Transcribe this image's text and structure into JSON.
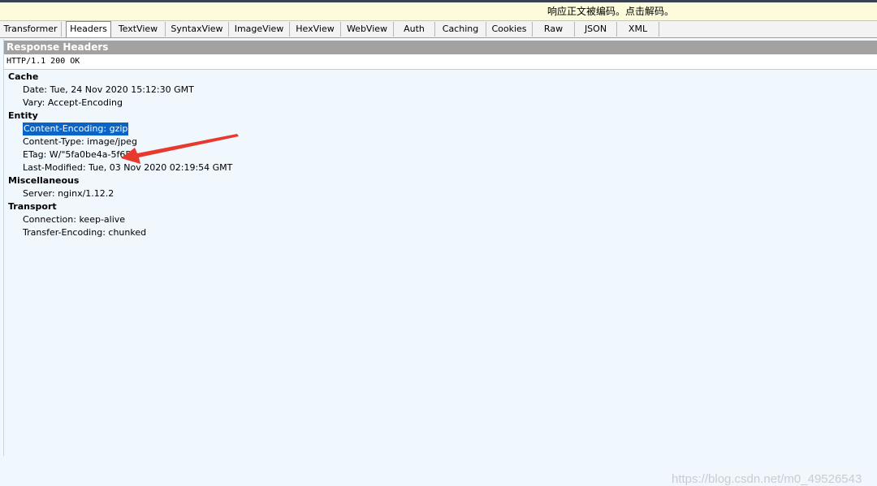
{
  "notice": {
    "text": "响应正文被编码。点击解码。"
  },
  "tabs": [
    {
      "label": "Transformer"
    },
    {
      "label": "Headers"
    },
    {
      "label": "TextView"
    },
    {
      "label": "SyntaxView"
    },
    {
      "label": "ImageView"
    },
    {
      "label": "HexView"
    },
    {
      "label": "WebView"
    },
    {
      "label": "Auth"
    },
    {
      "label": "Caching"
    },
    {
      "label": "Cookies"
    },
    {
      "label": "Raw"
    },
    {
      "label": "JSON"
    },
    {
      "label": "XML"
    }
  ],
  "active_tab": "Headers",
  "section_title": "Response Headers",
  "status_line": "HTTP/1.1 200 OK",
  "groups": [
    {
      "name": "Cache",
      "headers": [
        "Date: Tue, 24 Nov 2020 15:12:30 GMT",
        "Vary: Accept-Encoding"
      ]
    },
    {
      "name": "Entity",
      "headers": [
        "Content-Encoding: gzip",
        "Content-Type: image/jpeg",
        "ETag: W/\"5fa0be4a-5f65\"",
        "Last-Modified: Tue, 03 Nov 2020 02:19:54 GMT"
      ]
    },
    {
      "name": "Miscellaneous",
      "headers": [
        "Server: nginx/1.12.2"
      ]
    },
    {
      "name": "Transport",
      "headers": [
        "Connection: keep-alive",
        "Transfer-Encoding: chunked"
      ]
    }
  ],
  "selected_header": "Content-Encoding: gzip",
  "annotation": {
    "color": "#e8392f"
  },
  "watermark": "https://blog.csdn.net/m0_49526543",
  "colors": {
    "selection": "#0a64c8",
    "section_header": "#a2a2a2",
    "notice_bg": "#fcfcdd",
    "panel_bg": "#f0f7fd"
  }
}
